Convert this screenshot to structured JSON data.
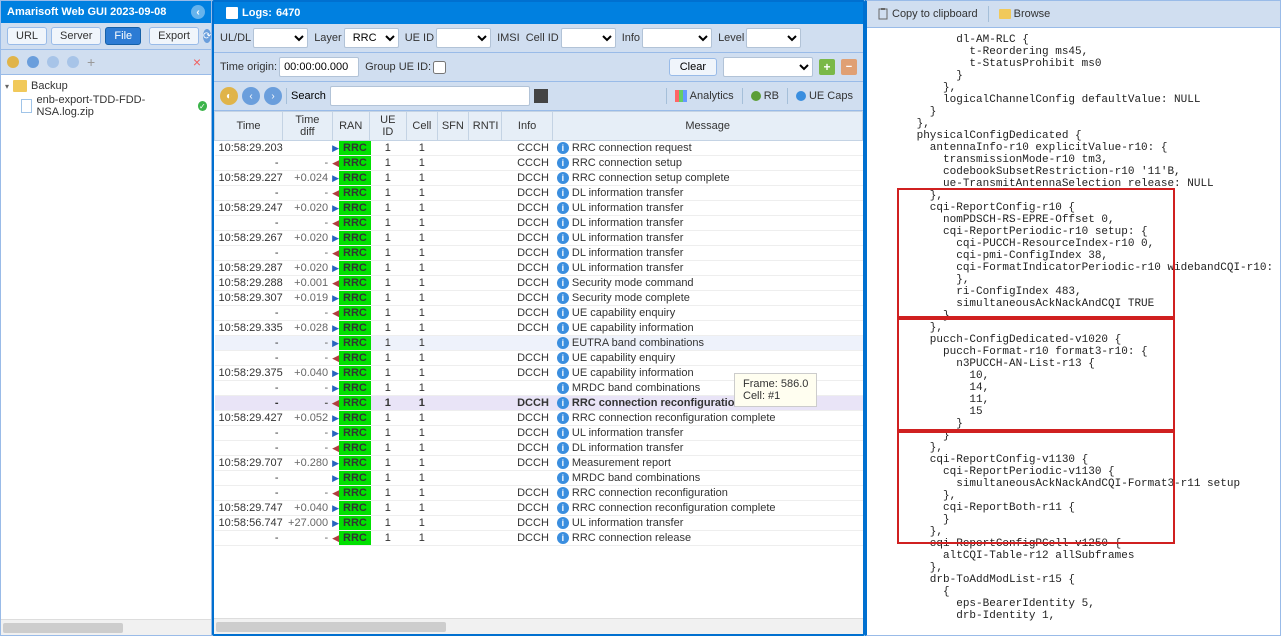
{
  "app": {
    "title": "Amarisoft Web GUI 2023-09-08"
  },
  "left": {
    "buttons": {
      "url": "URL",
      "server": "Server",
      "file": "File",
      "export": "Export"
    },
    "tree": {
      "root": "Backup",
      "file": "enb-export-TDD-FDD-NSA.log.zip"
    }
  },
  "center": {
    "tab": {
      "label": "Logs:",
      "count": "6470"
    },
    "filters": {
      "uldl": "UL/DL",
      "layer": "Layer",
      "layer_val": "RRC",
      "ueid": "UE ID",
      "imsi": "IMSI",
      "cellid": "Cell ID",
      "info": "Info",
      "level": "Level",
      "time_origin": "Time origin:",
      "time_origin_val": "00:00:00.000",
      "group_ueid": "Group UE ID:",
      "clear": "Clear",
      "search": "Search",
      "analytics": "Analytics",
      "rb": "RB",
      "uecaps": "UE Caps"
    },
    "columns": [
      "Time",
      "Time diff",
      "RAN",
      "UE ID",
      "Cell",
      "SFN",
      "RNTI",
      "Info",
      "Message"
    ],
    "rows": [
      {
        "time": "10:58:29.203",
        "diff": "",
        "dir": "r",
        "ran": "RRC",
        "ueid": "1",
        "cell": "1",
        "info": "CCCH",
        "msg": "RRC connection request"
      },
      {
        "time": "-",
        "diff": "-",
        "dir": "l",
        "ran": "RRC",
        "ueid": "1",
        "cell": "1",
        "info": "CCCH",
        "msg": "RRC connection setup"
      },
      {
        "time": "10:58:29.227",
        "diff": "+0.024",
        "dir": "r",
        "ran": "RRC",
        "ueid": "1",
        "cell": "1",
        "info": "DCCH",
        "msg": "RRC connection setup complete"
      },
      {
        "time": "-",
        "diff": "-",
        "dir": "l",
        "ran": "RRC",
        "ueid": "1",
        "cell": "1",
        "info": "DCCH",
        "msg": "DL information transfer"
      },
      {
        "time": "10:58:29.247",
        "diff": "+0.020",
        "dir": "r",
        "ran": "RRC",
        "ueid": "1",
        "cell": "1",
        "info": "DCCH",
        "msg": "UL information transfer"
      },
      {
        "time": "-",
        "diff": "-",
        "dir": "l",
        "ran": "RRC",
        "ueid": "1",
        "cell": "1",
        "info": "DCCH",
        "msg": "DL information transfer"
      },
      {
        "time": "10:58:29.267",
        "diff": "+0.020",
        "dir": "r",
        "ran": "RRC",
        "ueid": "1",
        "cell": "1",
        "info": "DCCH",
        "msg": "UL information transfer"
      },
      {
        "time": "-",
        "diff": "-",
        "dir": "l",
        "ran": "RRC",
        "ueid": "1",
        "cell": "1",
        "info": "DCCH",
        "msg": "DL information transfer"
      },
      {
        "time": "10:58:29.287",
        "diff": "+0.020",
        "dir": "r",
        "ran": "RRC",
        "ueid": "1",
        "cell": "1",
        "info": "DCCH",
        "msg": "UL information transfer"
      },
      {
        "time": "10:58:29.288",
        "diff": "+0.001",
        "dir": "l",
        "ran": "RRC",
        "ueid": "1",
        "cell": "1",
        "info": "DCCH",
        "msg": "Security mode command"
      },
      {
        "time": "10:58:29.307",
        "diff": "+0.019",
        "dir": "r",
        "ran": "RRC",
        "ueid": "1",
        "cell": "1",
        "info": "DCCH",
        "msg": "Security mode complete"
      },
      {
        "time": "-",
        "diff": "-",
        "dir": "l",
        "ran": "RRC",
        "ueid": "1",
        "cell": "1",
        "info": "DCCH",
        "msg": "UE capability enquiry"
      },
      {
        "time": "10:58:29.335",
        "diff": "+0.028",
        "dir": "r",
        "ran": "RRC",
        "ueid": "1",
        "cell": "1",
        "info": "DCCH",
        "msg": "UE capability information"
      },
      {
        "time": "-",
        "diff": "-",
        "dir": "r",
        "ran": "RRC",
        "ueid": "1",
        "cell": "1",
        "info": "",
        "msg": "EUTRA band combinations",
        "sub": true
      },
      {
        "time": "-",
        "diff": "-",
        "dir": "l",
        "ran": "RRC",
        "ueid": "1",
        "cell": "1",
        "info": "DCCH",
        "msg": "UE capability enquiry"
      },
      {
        "time": "10:58:29.375",
        "diff": "+0.040",
        "dir": "r",
        "ran": "RRC",
        "ueid": "1",
        "cell": "1",
        "info": "DCCH",
        "msg": "UE capability information"
      },
      {
        "time": "-",
        "diff": "-",
        "dir": "r",
        "ran": "RRC",
        "ueid": "1",
        "cell": "1",
        "info": "",
        "msg": "MRDC band combinations"
      },
      {
        "time": "-",
        "diff": "-",
        "dir": "l",
        "ran": "RRC",
        "ueid": "1",
        "cell": "1",
        "info": "DCCH",
        "msg": "RRC connection reconfiguration",
        "hl": true
      },
      {
        "time": "10:58:29.427",
        "diff": "+0.052",
        "dir": "r",
        "ran": "RRC",
        "ueid": "1",
        "cell": "1",
        "info": "DCCH",
        "msg": "RRC connection reconfiguration complete"
      },
      {
        "time": "-",
        "diff": "-",
        "dir": "r",
        "ran": "RRC",
        "ueid": "1",
        "cell": "1",
        "info": "DCCH",
        "msg": "UL information transfer"
      },
      {
        "time": "-",
        "diff": "-",
        "dir": "l",
        "ran": "RRC",
        "ueid": "1",
        "cell": "1",
        "info": "DCCH",
        "msg": "DL information transfer"
      },
      {
        "time": "10:58:29.707",
        "diff": "+0.280",
        "dir": "r",
        "ran": "RRC",
        "ueid": "1",
        "cell": "1",
        "info": "DCCH",
        "msg": "Measurement report"
      },
      {
        "time": "-",
        "diff": "",
        "dir": "r",
        "ran": "RRC",
        "ueid": "1",
        "cell": "1",
        "info": "",
        "msg": "MRDC band combinations"
      },
      {
        "time": "-",
        "diff": "-",
        "dir": "l",
        "ran": "RRC",
        "ueid": "1",
        "cell": "1",
        "info": "DCCH",
        "msg": "RRC connection reconfiguration"
      },
      {
        "time": "10:58:29.747",
        "diff": "+0.040",
        "dir": "r",
        "ran": "RRC",
        "ueid": "1",
        "cell": "1",
        "info": "DCCH",
        "msg": "RRC connection reconfiguration complete"
      },
      {
        "time": "10:58:56.747",
        "diff": "+27.000",
        "dir": "r",
        "ran": "RRC",
        "ueid": "1",
        "cell": "1",
        "info": "DCCH",
        "msg": "UL information transfer"
      },
      {
        "time": "-",
        "diff": "-",
        "dir": "l",
        "ran": "RRC",
        "ueid": "1",
        "cell": "1",
        "info": "DCCH",
        "msg": "RRC connection release"
      }
    ],
    "tooltip": {
      "line1": "Frame: 586.0",
      "line2": "Cell: #1"
    }
  },
  "right": {
    "copy": "Copy to clipboard",
    "browse": "Browse",
    "details": "            dl-AM-RLC {\n              t-Reordering ms45,\n              t-StatusProhibit ms0\n            }\n          },\n          logicalChannelConfig defaultValue: NULL\n        }\n      },\n      physicalConfigDedicated {\n        antennaInfo-r10 explicitValue-r10: {\n          transmissionMode-r10 tm3,\n          codebookSubsetRestriction-r10 '11'B,\n          ue-TransmitAntennaSelection release: NULL\n        },\n        cqi-ReportConfig-r10 {\n          nomPDSCH-RS-EPRE-Offset 0,\n          cqi-ReportPeriodic-r10 setup: {\n            cqi-PUCCH-ResourceIndex-r10 0,\n            cqi-pmi-ConfigIndex 38,\n            cqi-FormatIndicatorPeriodic-r10 widebandCQI-r10: {\n            },\n            ri-ConfigIndex 483,\n            simultaneousAckNackAndCQI TRUE\n          }\n        },\n        pucch-ConfigDedicated-v1020 {\n          pucch-Format-r10 format3-r10: {\n            n3PUCCH-AN-List-r13 {\n              10,\n              14,\n              11,\n              15\n            }\n          }\n        },\n        cqi-ReportConfig-v1130 {\n          cqi-ReportPeriodic-v1130 {\n            simultaneousAckNackAndCQI-Format3-r11 setup\n          },\n          cqi-ReportBoth-r11 {\n          }\n        },\n        cqi-ReportConfigPCell-v1250 {\n          altCQI-Table-r12 allSubframes\n        },\n        drb-ToAddModList-r15 {\n          {\n            eps-BearerIdentity 5,\n            drb-Identity 1,"
  }
}
